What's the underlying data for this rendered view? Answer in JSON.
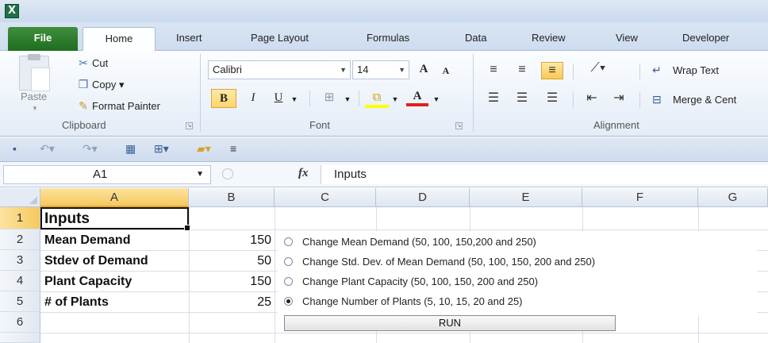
{
  "app": {
    "icon_glyph": "X"
  },
  "tabs": [
    {
      "label": "File"
    },
    {
      "label": "Home"
    },
    {
      "label": "Insert"
    },
    {
      "label": "Page Layout"
    },
    {
      "label": "Formulas"
    },
    {
      "label": "Data"
    },
    {
      "label": "Review"
    },
    {
      "label": "View"
    },
    {
      "label": "Developer"
    }
  ],
  "ribbon": {
    "clipboard": {
      "paste_label": "Paste",
      "cut_label": "Cut",
      "copy_label": "Copy ▾",
      "format_painter_label": "Format Painter",
      "group_label": "Clipboard"
    },
    "font": {
      "font_name": "Calibri",
      "font_size": "14",
      "grow_label": "A",
      "shrink_label": "A",
      "bold_label": "B",
      "italic_label": "I",
      "underline_label": "U",
      "font_color_label": "A",
      "group_label": "Font"
    },
    "alignment": {
      "wrap_text_label": "Wrap Text",
      "merge_label": "Merge & Cent",
      "group_label": "Alignment"
    }
  },
  "formula_bar": {
    "name_box": "A1",
    "fx_label": "fx",
    "value": "Inputs"
  },
  "sheet": {
    "columns": [
      "A",
      "B",
      "C",
      "D",
      "E",
      "F",
      "G"
    ],
    "rows": [
      "1",
      "2",
      "3",
      "4",
      "5",
      "6"
    ],
    "cells": {
      "A1": "Inputs",
      "A2": "Mean Demand",
      "A3": "Stdev of Demand",
      "A4": "Plant Capacity",
      "A5": "# of Plants",
      "B2": "150",
      "B3": "50",
      "B4": "150",
      "B5": "25"
    },
    "options": [
      {
        "label": "Change Mean Demand (50, 100, 150,200 and 250)",
        "selected": false
      },
      {
        "label": "Change Std. Dev. of Mean Demand (50, 100, 150, 200 and 250)",
        "selected": false
      },
      {
        "label": "Change Plant Capacity (50, 100, 150, 200 and 250)",
        "selected": false
      },
      {
        "label": "Change Number of Plants (5, 10, 15, 20 and 25)",
        "selected": true
      }
    ],
    "run_button_label": "RUN"
  },
  "colors": {
    "file_tab": "#2f7f2f",
    "selection_header": "#f7c95d",
    "active_button": "#fcd56d"
  }
}
